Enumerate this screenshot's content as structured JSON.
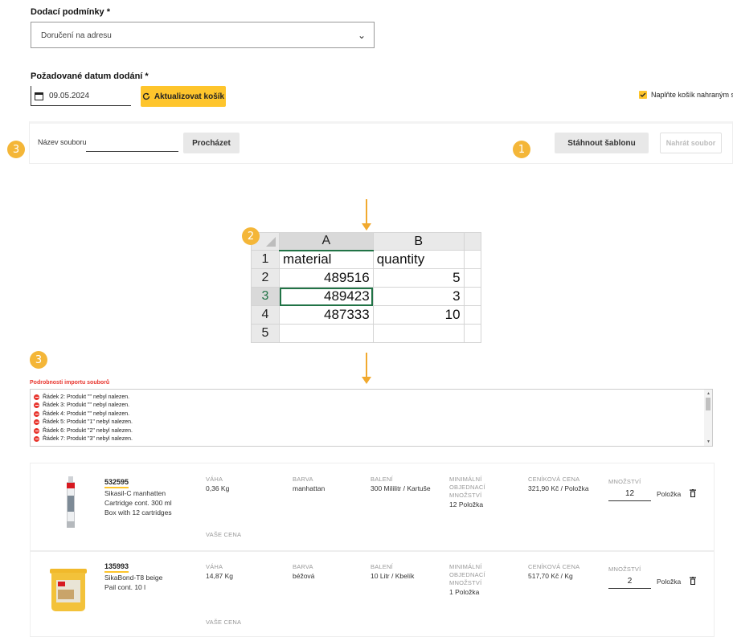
{
  "delivery": {
    "label": "Dodací podmínky *",
    "selected": "Doručení na adresu"
  },
  "date": {
    "label": "Požadované datum dodání *",
    "value": "09.05.2024",
    "update_button": "Aktualizovat košík"
  },
  "fill_cart_checkbox": {
    "label": "Naplňte košík nahraným souborem",
    "checked": true
  },
  "upload": {
    "file_label": "Název souboru",
    "file_value": "",
    "browse_button": "Procházet",
    "download_template_button": "Stáhnout šablonu",
    "upload_button": "Nahrát soubor"
  },
  "badges": {
    "b1": "1",
    "b2": "2",
    "b3a": "3",
    "b3b": "3"
  },
  "spreadsheet": {
    "columns": [
      "A",
      "B"
    ],
    "rows": [
      {
        "n": "1",
        "a": "material",
        "b": "quantity"
      },
      {
        "n": "2",
        "a": "489516",
        "b": "5"
      },
      {
        "n": "3",
        "a": "489423",
        "b": "3"
      },
      {
        "n": "4",
        "a": "487333",
        "b": "10"
      },
      {
        "n": "5",
        "a": "",
        "b": ""
      }
    ]
  },
  "import": {
    "title": "Podrobnosti importu souborů",
    "messages": [
      "Řádek 2: Produkt \"\" nebyl nalezen.",
      "Řádek 3: Produkt \"\" nebyl nalezen.",
      "Řádek 4: Produkt \"\" nebyl nalezen.",
      "Řádek 5: Produkt \"1\" nebyl nalezen.",
      "Řádek 6: Produkt \"2\" nebyl nalezen.",
      "Řádek 7: Produkt \"3\" nebyl nalezen."
    ]
  },
  "columns": {
    "weight": "VÁHA",
    "color": "BARVA",
    "packaging": "BALENÍ",
    "min_order": "MINIMÁLNÍ OBJEDNACÍ MNOŽSTVÍ",
    "list_price": "CENÍKOVÁ CENA",
    "quantity": "MNOŽSTVÍ",
    "your_price": "VAŠE CENA"
  },
  "products": [
    {
      "id": "532595",
      "desc": [
        "Sikasil-C manhatten",
        "Cartridge cont. 300 ml",
        "Box with 12 cartridges"
      ],
      "weight": "0,36 Kg",
      "color": "manhattan",
      "packaging": "300 Mililitr / Kartuše",
      "min_order": "12 Položka",
      "list_price": "321,90 Kč / Položka",
      "qty": "12",
      "unit": "Položka"
    },
    {
      "id": "135993",
      "desc": [
        "SikaBond-T8 beige",
        "Pail cont. 10 l"
      ],
      "weight": "14,87 Kg",
      "color": "béžová",
      "packaging": "10 Litr / Kbelík",
      "min_order": "1 Položka",
      "list_price": "517,70 Kč / Kg",
      "qty": "2",
      "unit": "Položka"
    }
  ],
  "colors": {
    "accent": "#fec52c",
    "badge": "#f4b638",
    "error": "#e8342c",
    "excel_green": "#217346"
  },
  "icons": {
    "calendar": "calendar-icon",
    "refresh": "refresh-icon",
    "chevron": "chevron-down-icon",
    "trash": "trash-icon",
    "error": "error-icon",
    "checkbox": "checkbox-icon"
  }
}
